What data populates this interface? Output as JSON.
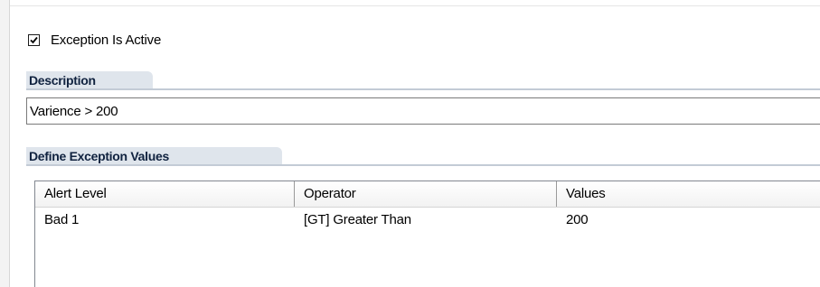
{
  "exception_active": {
    "label": "Exception Is Active",
    "checked": true
  },
  "description": {
    "section_label": "Description",
    "value": "Varience > 200"
  },
  "exception_values": {
    "section_label": "Define Exception Values",
    "columns": [
      "Alert Level",
      "Operator",
      "Values"
    ],
    "rows": [
      [
        "Bad 1",
        "[GT] Greater Than",
        "200"
      ]
    ]
  }
}
